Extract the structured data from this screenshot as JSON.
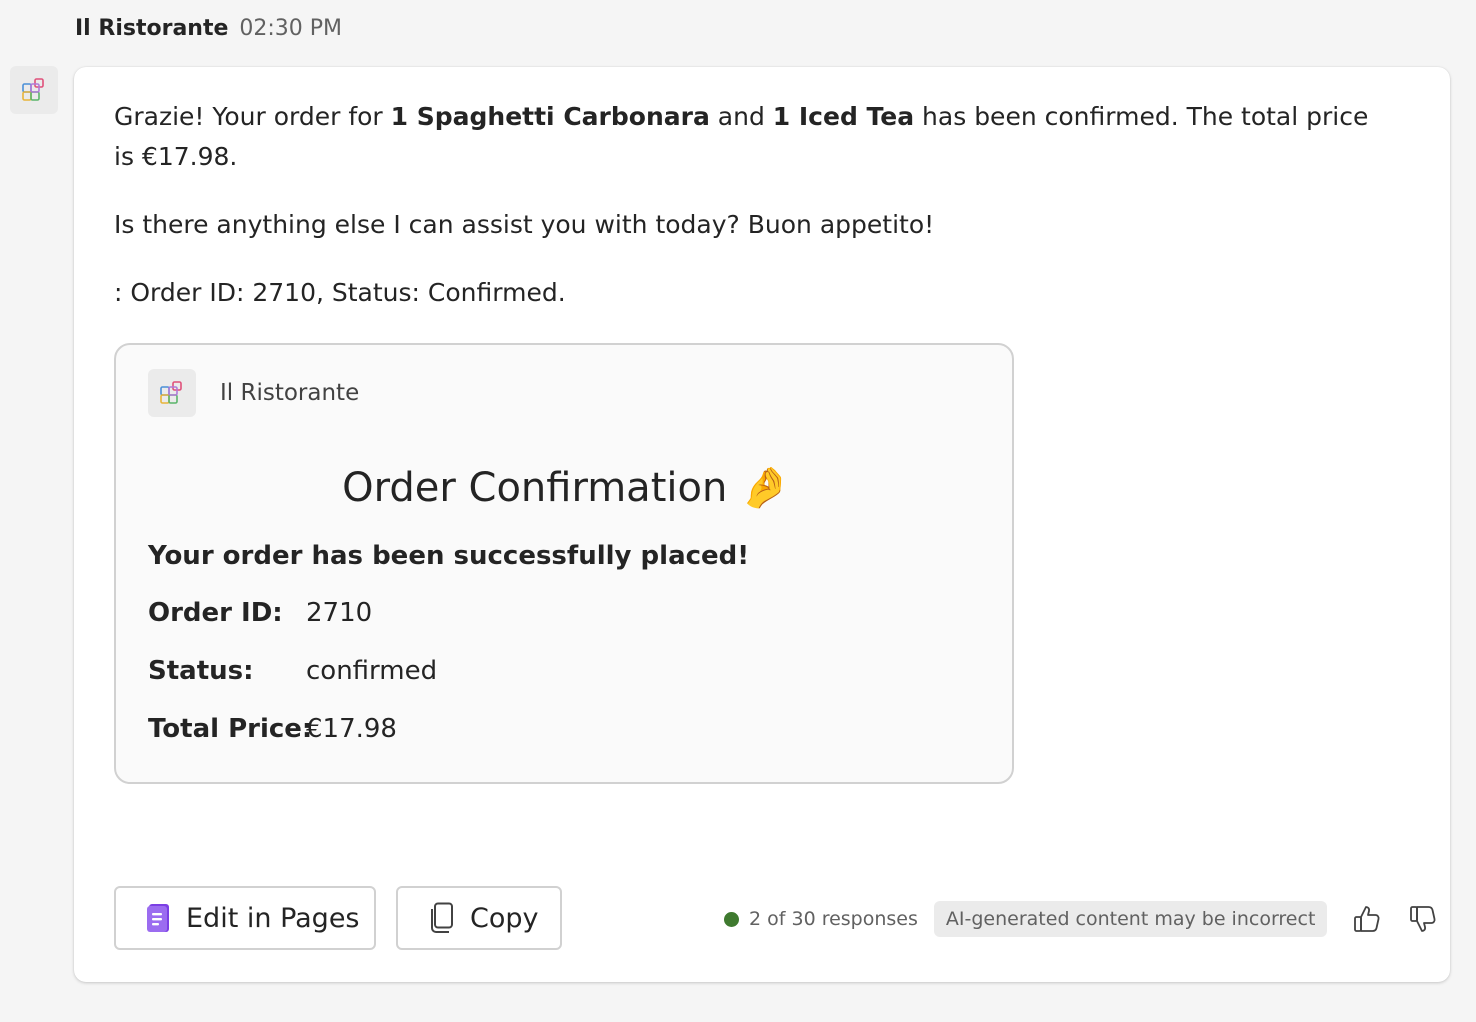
{
  "header": {
    "sender": "Il Ristorante",
    "time": "02:30 PM"
  },
  "message": {
    "p1": {
      "a": "Grazie! Your order for ",
      "item1": "1 Spaghetti Carbonara",
      "b": " and ",
      "item2": "1 Iced Tea",
      "c": " has been confirmed. The total price is €17.98."
    },
    "p2": "Is there anything else I can assist you with today? Buon appetito!",
    "p3": ": Order ID: 2710, Status: Confirmed."
  },
  "card": {
    "app_name": "Il Ristorante",
    "title": "Order Confirmation",
    "title_emoji": "🤌",
    "subtitle": "Your order has been successfully placed!",
    "facts": [
      {
        "key": "Order ID:",
        "value": "2710"
      },
      {
        "key": "Status:",
        "value": "confirmed"
      },
      {
        "key": "Total Price:",
        "value": "€17.98"
      }
    ]
  },
  "footer": {
    "edit_label": "Edit in Pages",
    "copy_label": "Copy",
    "responses": "2 of 30 responses",
    "ai_notice": "AI-generated content may be incorrect"
  },
  "colors": {
    "status_dot": "#3f7a2f",
    "pages_icon": "#7b3fe4"
  },
  "icons": [
    "apps-icon",
    "pages-icon",
    "copy-icon",
    "thumbs-up-icon",
    "thumbs-down-icon"
  ]
}
